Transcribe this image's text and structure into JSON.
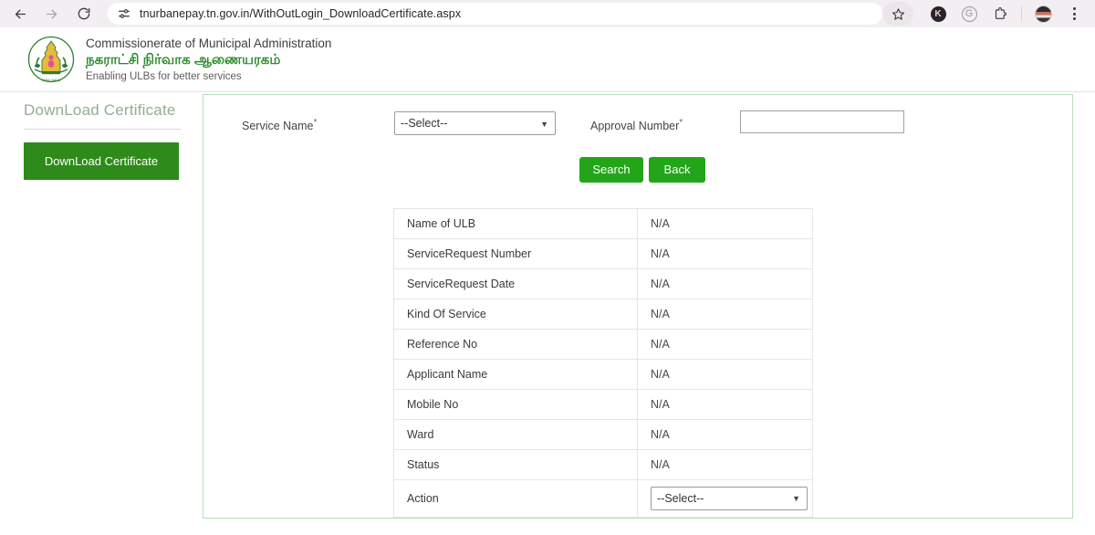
{
  "browser": {
    "back_icon": "arrow-left-icon",
    "forward_icon": "arrow-right-icon",
    "reload_icon": "reload-icon",
    "site_settings_icon": "tune-sliders-icon",
    "url": "tnurbanepay.tn.gov.in/WithOutLogin_DownloadCertificate.aspx",
    "bookmark_icon": "star-icon",
    "extension_k_label": "K",
    "extension_g_label": "G",
    "extensions_icon": "puzzle-piece-icon",
    "profile_icon": "avatar",
    "menu_icon": "three-dot-menu-icon"
  },
  "site_header": {
    "emblem_alt": "tamil-nadu-government-emblem",
    "line1": "Commissionerate of Municipal Administration",
    "line2": "நகராட்சி நிர்வாக ஆணையரகம்",
    "line3": "Enabling ULBs for better services",
    "accent_color": "#2e8b2e"
  },
  "sidebar": {
    "title": "DownLoad Certificate",
    "button_label": "DownLoad Certificate",
    "button_color": "#2e8b19",
    "title_color": "#93ad93"
  },
  "form": {
    "service_name_label": "Service Name",
    "service_name_required": "*",
    "service_name_value": "--Select--",
    "service_name_options": [
      "--Select--"
    ],
    "approval_number_label": "Approval Number",
    "approval_number_required": "*",
    "approval_number_value": "",
    "approval_number_placeholder": "",
    "search_label": "Search",
    "back_label": "Back",
    "button_color": "#23a519",
    "chevron_icon": "chevron-down-icon"
  },
  "table": {
    "rows": [
      {
        "key": "Name of ULB",
        "value": "N/A",
        "type": "text"
      },
      {
        "key": "ServiceRequest Number",
        "value": "N/A",
        "type": "text"
      },
      {
        "key": "ServiceRequest Date",
        "value": "N/A",
        "type": "text"
      },
      {
        "key": "Kind Of Service",
        "value": "N/A",
        "type": "text"
      },
      {
        "key": "Reference No",
        "value": "N/A",
        "type": "text"
      },
      {
        "key": "Applicant Name",
        "value": "N/A",
        "type": "text"
      },
      {
        "key": "Mobile No",
        "value": "N/A",
        "type": "text"
      },
      {
        "key": "Ward",
        "value": "N/A",
        "type": "text"
      },
      {
        "key": "Status",
        "value": "N/A",
        "type": "text"
      },
      {
        "key": "Action",
        "value": "--Select--",
        "type": "select"
      }
    ],
    "action_options": [
      "--Select--"
    ]
  },
  "panel": {
    "border_color": "#b8ddb8"
  }
}
